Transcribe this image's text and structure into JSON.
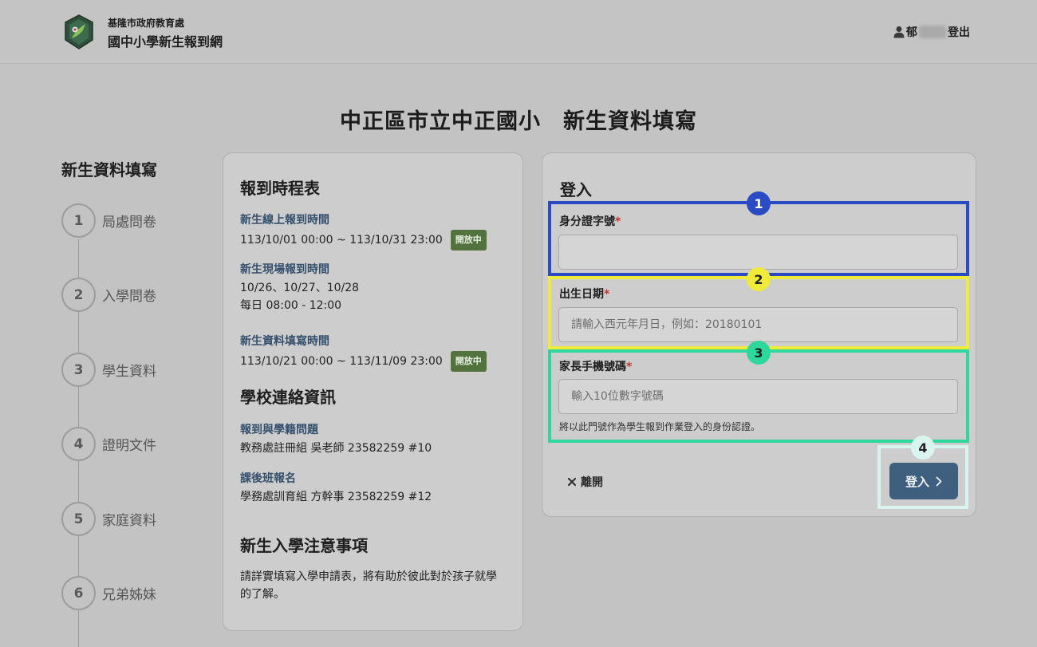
{
  "header": {
    "org_name": "基隆市政府教育處",
    "site_name": "國中小學新生報到網",
    "user_name": "郁",
    "logout_label": "登出"
  },
  "page_title": "中正區市立中正國小　新生資料填寫",
  "steps": {
    "title": "新生資料填寫",
    "items": [
      {
        "num": "1",
        "label": "局處問卷"
      },
      {
        "num": "2",
        "label": "入學問卷"
      },
      {
        "num": "3",
        "label": "學生資料"
      },
      {
        "num": "4",
        "label": "證明文件"
      },
      {
        "num": "5",
        "label": "家庭資料"
      },
      {
        "num": "6",
        "label": "兄弟姊妹"
      }
    ]
  },
  "info": {
    "schedule_title": "報到時程表",
    "online_label": "新生線上報到時間",
    "online_time": "113/10/01 00:00 ~ 113/10/31 23:00",
    "online_badge": "開放中",
    "onsite_label": "新生現場報到時間",
    "onsite_dates": "10/26、10/27、10/28",
    "onsite_hours": "每日 08:00 - 12:00",
    "fill_label": "新生資料填寫時間",
    "fill_time": "113/10/21 00:00 ~ 113/11/09 23:00",
    "fill_badge": "開放中",
    "contact_title": "學校連絡資訊",
    "contact1_label": "報到與學籍問題",
    "contact1_text": "教務處註冊組 吳老師 23582259 #10",
    "contact2_label": "課後班報名",
    "contact2_text": "學務處訓育組 方幹事 23582259 #12",
    "notice_title": "新生入學注意事項",
    "notice_text_1": "請詳實填寫入學申請表，將有助於彼此對於孩子就學",
    "notice_text_2": "的了解。"
  },
  "login": {
    "title": "登入",
    "id_label": "身分證字號",
    "id_value": "",
    "id_placeholder": "",
    "birth_label": "出生日期",
    "birth_placeholder": "請輸入西元年月日，例如：20180101",
    "phone_label": "家長手機號碼",
    "phone_placeholder": "輸入10位數字號碼",
    "phone_hint": "將以此門號作為學生報到作業登入的身份認證。",
    "required_mark": "*",
    "leave_label": "離開",
    "submit_label": "登入"
  },
  "annotations": [
    "1",
    "2",
    "3",
    "4"
  ],
  "colors": {
    "annotation_1": "#2a4bc4",
    "annotation_2": "#f0ea38",
    "annotation_3": "#2ed89d",
    "annotation_4": "#d9f3ee",
    "badge_green": "#52733d",
    "submit_button": "#3f5f7f",
    "link_label": "#34506d"
  }
}
